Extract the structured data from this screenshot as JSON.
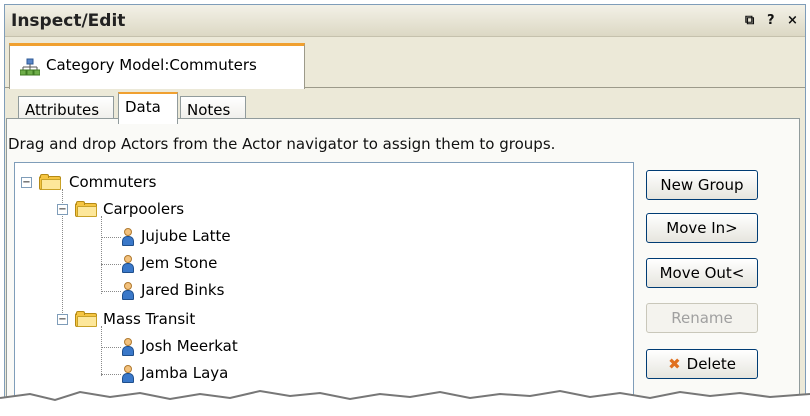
{
  "window": {
    "title": "Inspect/Edit",
    "controls": {
      "restore": "⧉",
      "help": "?",
      "close": "×"
    }
  },
  "doc_tab": {
    "label": "Category Model:Commuters",
    "icon": "hierarchy-icon"
  },
  "sub_tabs": [
    {
      "label": "Attributes",
      "active": false
    },
    {
      "label": "Data",
      "active": true
    },
    {
      "label": "Notes",
      "active": false
    }
  ],
  "instruction": "Drag and drop Actors from the Actor navigator to assign them to groups.",
  "tree": {
    "root": "Commuters",
    "groups": [
      {
        "label": "Carpoolers",
        "actors": [
          "Jujube Latte",
          "Jem Stone",
          "Jared Binks"
        ]
      },
      {
        "label": "Mass Transit",
        "actors": [
          "Josh Meerkat",
          "Jamba Laya"
        ]
      }
    ],
    "expander_open": "−"
  },
  "buttons": {
    "new_group": "New Group",
    "move_in": "Move In>",
    "move_out": "Move Out<",
    "rename": "Rename",
    "delete": "Delete",
    "delete_icon": "✖"
  },
  "colors": {
    "active_tab_accent": "#f0a030",
    "folder": "#f5c542",
    "actor": "#3a78c9"
  }
}
